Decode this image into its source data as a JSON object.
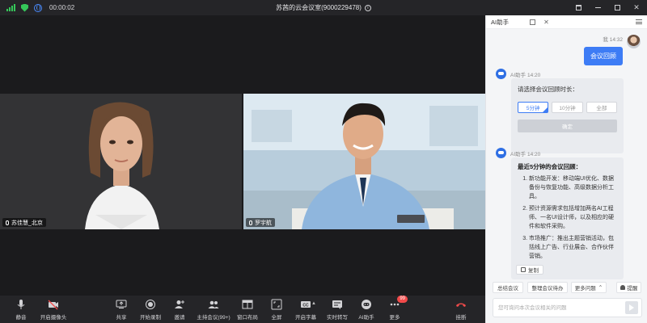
{
  "topbar": {
    "timer": "00:00:02",
    "meeting_title": "苏茜的云会议室(9000229478)"
  },
  "participants": [
    {
      "name": "苏佳慧_北京"
    },
    {
      "name": "罗宇航"
    }
  ],
  "toolbar": {
    "mute": "静音",
    "camera": "开启摄像头",
    "share": "共享",
    "record": "开始录制",
    "invite": "邀请",
    "host": "主持会议(99+)",
    "layout": "窗口布局",
    "fullscreen": "全屏",
    "caption": "开启字幕",
    "transcript": "实时转写",
    "ai": "AI助手",
    "more": "更多",
    "more_badge": "99",
    "end": "挂断"
  },
  "panel": {
    "tab_title": "AI助手",
    "user_name": "我",
    "user_time": "14:32",
    "user_message": "会议回顾",
    "ai_name": "AI助手",
    "ai_time_1": "14:20",
    "question": "请选择会议回顾时长：",
    "options": [
      "5分钟",
      "10分钟",
      "全部"
    ],
    "confirm": "确定",
    "ai_time_2": "14:20",
    "summary_title": "最近5分钟的会议回顾：",
    "summary_items": [
      "新功能开发：移动端UI优化、数据备份与恢复功能、高级数据分析工具。",
      "预计资源需求包括增加两名AI工程师、一名UI设计师，以及相应的硬件和软件采购。",
      "市场推广：推出主题营销活动，包括线上广告、行业展会、合作伙伴营销。"
    ],
    "copy": "复制",
    "chips": {
      "summary": "总结会议",
      "todo": "整理会议待办",
      "more": "更多问题",
      "remind": "提醒"
    },
    "input_placeholder": "您可询问本次会议相关的问题"
  },
  "colors": {
    "accent": "#3d7cf5",
    "signal": "#35c759",
    "hangup": "#f24a4a"
  },
  "icons": [
    "signal-icon",
    "shield-icon",
    "globe-icon",
    "info-icon",
    "mic-icon",
    "camera-off-icon",
    "share-icon",
    "record-icon",
    "invite-icon",
    "participants-icon",
    "layout-icon",
    "fullscreen-icon",
    "caption-icon",
    "transcript-icon",
    "ai-icon",
    "more-icon",
    "hangup-icon",
    "send-icon"
  ]
}
